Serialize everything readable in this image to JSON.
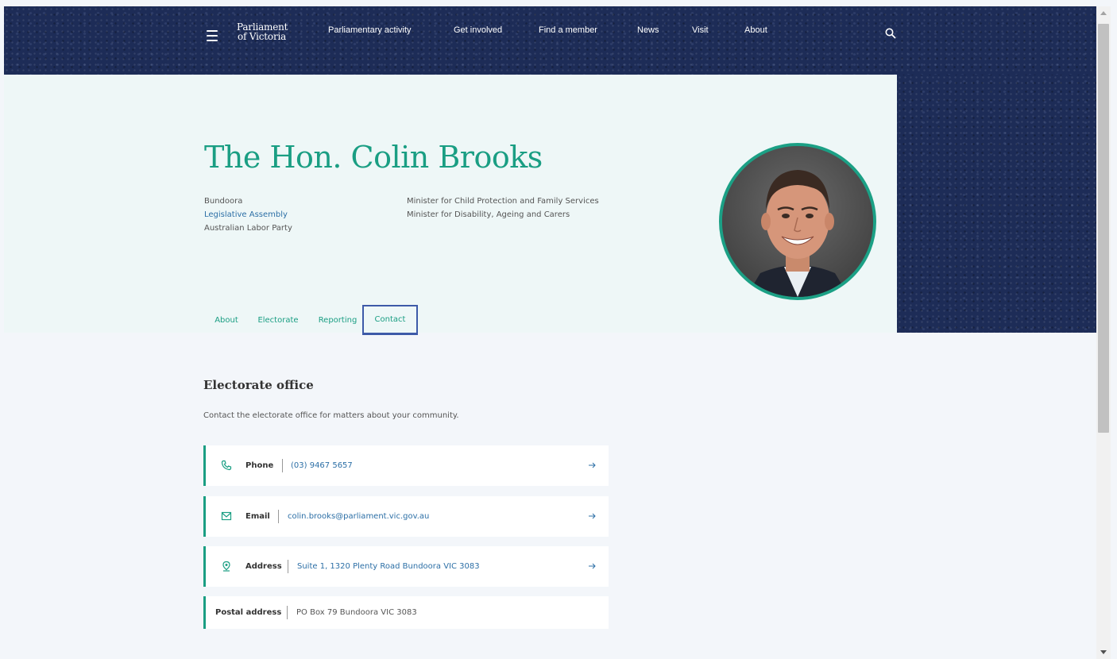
{
  "header": {
    "logo_line1": "Parliament",
    "logo_line2": "of Victoria",
    "nav": [
      {
        "label": "Parliamentary activity"
      },
      {
        "label": "Get involved"
      },
      {
        "label": "Find a member"
      },
      {
        "label": "News"
      },
      {
        "label": "Visit"
      },
      {
        "label": "About"
      }
    ]
  },
  "member": {
    "name": "The Hon. Colin Brooks",
    "electorate": "Bundoora",
    "house": "Legislative Assembly",
    "party": "Australian Labor Party",
    "roles": [
      "Minister for Child Protection and Family Services",
      "Minister for Disability, Ageing and Carers"
    ]
  },
  "tabs": [
    {
      "label": "About",
      "active": false
    },
    {
      "label": "Electorate",
      "active": false
    },
    {
      "label": "Reporting",
      "active": false
    },
    {
      "label": "Contact",
      "active": true
    }
  ],
  "electorate_office": {
    "title": "Electorate office",
    "description": "Contact the electorate office for matters about your community.",
    "contacts": {
      "phone": {
        "label": "Phone",
        "value": "(03) 9467 5657",
        "icon": "phone-icon"
      },
      "email": {
        "label": "Email",
        "value": "colin.brooks@parliament.vic.gov.au",
        "icon": "email-icon"
      },
      "address": {
        "label": "Address",
        "value": "Suite 1, 1320 Plenty Road Bundoora VIC 3083",
        "icon": "location-pin-icon"
      },
      "postal": {
        "label": "Postal address",
        "value": "PO Box 79 Bundoora VIC 3083"
      }
    }
  },
  "colors": {
    "navy": "#1d2c57",
    "teal": "#1a9e83",
    "tab_active_border": "#3d5aa8",
    "hero_bg": "#eef7f7",
    "page_bg": "#f3f6fa"
  }
}
